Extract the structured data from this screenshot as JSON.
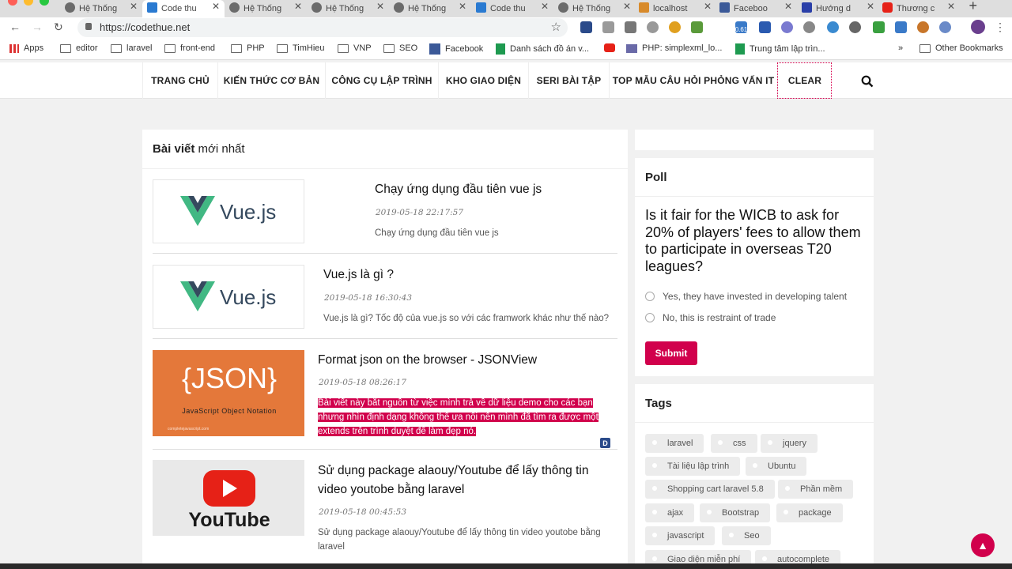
{
  "browser": {
    "tabs": [
      {
        "title": "Hệ Thống",
        "active": false
      },
      {
        "title": "Code thu",
        "active": true
      },
      {
        "title": "Hệ Thống",
        "active": false
      },
      {
        "title": "Hệ Thống",
        "active": false
      },
      {
        "title": "Hệ Thống",
        "active": false
      },
      {
        "title": "Code thu",
        "active": false
      },
      {
        "title": "Hệ Thống",
        "active": false
      },
      {
        "title": "localhost",
        "active": false
      },
      {
        "title": "Faceboo",
        "active": false
      },
      {
        "title": "Hướng d",
        "active": false
      },
      {
        "title": "Thương c",
        "active": false
      }
    ],
    "url": "https://codethue.net",
    "extension_badge": "0.61",
    "bookmarks": [
      "Apps",
      "editor",
      "laravel",
      "front-end",
      "PHP",
      "TimHieu",
      "VNP",
      "SEO",
      "Facebook",
      "Danh sách đồ án v...",
      "PHP: simplexml_lo...",
      "Trung tâm lập trìn..."
    ],
    "bookmarks_more": "»",
    "other_bookmarks": "Other Bookmarks"
  },
  "site": {
    "nav": [
      "TRANG CHỦ",
      "KIẾN THỨC CƠ BẢN",
      "CÔNG CỤ LẬP TRÌNH",
      "KHO GIAO DIỆN",
      "SERI BÀI TẬP",
      "TOP MẪU CÂU HỎI PHỎNG VẤN IT",
      "CLEAR"
    ],
    "latest_heading_bold": "Bài viết",
    "latest_heading_rest": " mới nhất",
    "posts": [
      {
        "title": "Chạy ứng dụng đầu tiên vue js",
        "date": "2019-05-18 22:17:57",
        "excerpt": "Chạy ứng dụng đầu tiên vue js",
        "thumb_text": "Vue.js"
      },
      {
        "title": "Vue.js là gì ?",
        "date": "2019-05-18 16:30:43",
        "excerpt": "Vue.js là gì? Tốc độ của vue.js so với các framwork khác như thế nào?",
        "thumb_text": "Vue.js"
      },
      {
        "title": "Format json on the browser - JSONView",
        "date": "2019-05-18 08:26:17",
        "excerpt": "Bài viết này bắt nguồn từ việc mình trả về dữ liệu demo cho các bạn nhưng nhìn định dạng không thể ưa nổi nên mình đã tìm ra được một extends trên trình duyệt để làm đẹp nó.",
        "thumb_text": "{JSON}",
        "thumb_sub": "JavaScript Object Notation",
        "thumb_footer": "completejavascript.com"
      },
      {
        "title": "Sử dụng package alaouy/Youtube để lấy thông tin video youtobe bằng laravel",
        "date": "2019-05-18 00:45:53",
        "excerpt": "Sử dụng package alaouy/Youtube để lấy thông tin video youtobe bằng laravel",
        "thumb_text": "YouTube"
      }
    ],
    "poll": {
      "title": "Poll",
      "question": "Is it fair for the WICB to ask for 20% of players' fees to allow them to participate in overseas T20 leagues?",
      "options": [
        "Yes, they have invested in developing talent",
        "No, this is restraint of trade"
      ],
      "submit": "Submit"
    },
    "tags": {
      "title": "Tags",
      "items": [
        "laravel",
        "css",
        "jquery",
        "Tài liệu lập trình",
        "Ubuntu",
        "Shopping cart laravel 5.8",
        "Phần mềm",
        "ajax",
        "Bootstrap",
        "package",
        "javascript",
        "Seo",
        "Giao diện miễn phí",
        "autocomplete"
      ]
    },
    "accent_color": "#d1004c"
  }
}
